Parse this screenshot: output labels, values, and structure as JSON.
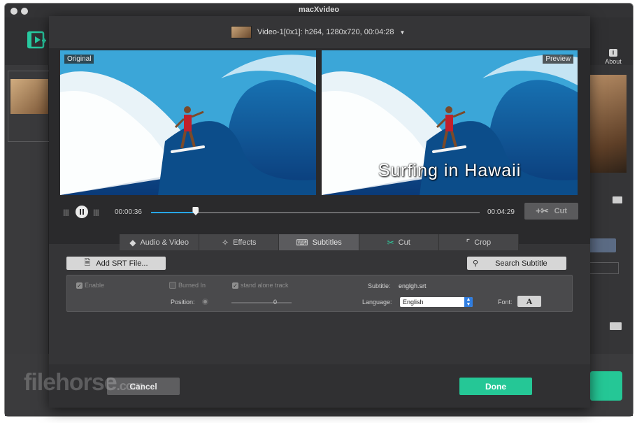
{
  "app": {
    "title": "macXvideo",
    "about_label": "About"
  },
  "dialog": {
    "video_info": "Video-1[0x1]: h264, 1280x720, 00:04:28",
    "original_label": "Original",
    "preview_label": "Preview",
    "subtitle_overlay_text": "Surfing in Hawaii",
    "player": {
      "current_time": "00:00:36",
      "total_time": "00:04:29",
      "progress_percent": 13.5,
      "cut_label": "Cut"
    },
    "tabs": [
      {
        "label": "Audio & Video",
        "icon": "audio-video-icon",
        "active": false
      },
      {
        "label": "Effects",
        "icon": "magic-wand-icon",
        "active": false
      },
      {
        "label": "Subtitles",
        "icon": "subtitles-icon",
        "active": true
      },
      {
        "label": "Cut",
        "icon": "scissors-icon",
        "active": false
      },
      {
        "label": "Crop",
        "icon": "crop-icon",
        "active": false
      }
    ],
    "subtitles": {
      "add_srt_label": "Add SRT File...",
      "search_label": "Search Subtitle",
      "enable_label": "Enable",
      "burned_in_label": "Burned In",
      "standalone_label": "stand alone track",
      "subtitle_label": "Subtitle:",
      "subtitle_file": "englgh.srt",
      "position_label": "Position:",
      "position_value": "0",
      "language_label": "Language:",
      "language_value": "English",
      "font_label": "Font:",
      "font_button_glyph": "A"
    },
    "footer": {
      "cancel_label": "Cancel",
      "done_label": "Done"
    }
  },
  "watermark": {
    "text": "filehorse",
    "suffix": ".com"
  },
  "colors": {
    "accent": "#25c796",
    "progress": "#27a6e6"
  }
}
